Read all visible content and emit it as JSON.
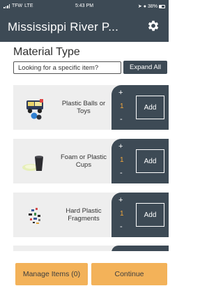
{
  "status_bar": {
    "carrier": "TFW",
    "network": "LTE",
    "time": "5:43 PM",
    "battery": "38%"
  },
  "header": {
    "title": "Mississippi River P...",
    "settings_icon": "gear-icon"
  },
  "material": {
    "section_title": "Material Type",
    "search_placeholder": "Looking for a specific item?",
    "expand_label": "Expand All"
  },
  "items": [
    {
      "label": "Plastic Balls or Toys",
      "quantity": "1",
      "plus": "+",
      "minus": "-",
      "add_label": "Add",
      "icon": "plastic-toys-icon"
    },
    {
      "label": "Foam or Plastic Cups",
      "quantity": "1",
      "plus": "+",
      "minus": "-",
      "add_label": "Add",
      "icon": "plastic-cup-icon"
    },
    {
      "label": "Hard Plastic Fragments",
      "quantity": "1",
      "plus": "+",
      "minus": "-",
      "add_label": "Add",
      "icon": "plastic-fragments-icon"
    }
  ],
  "footer": {
    "manage_label": "Manage Items (0)",
    "continue_label": "Continue"
  },
  "colors": {
    "header_bg": "#3d4a55",
    "accent_orange": "#f3b259",
    "quantity_orange": "#f3a73b",
    "card_bg": "#eeeeee"
  }
}
